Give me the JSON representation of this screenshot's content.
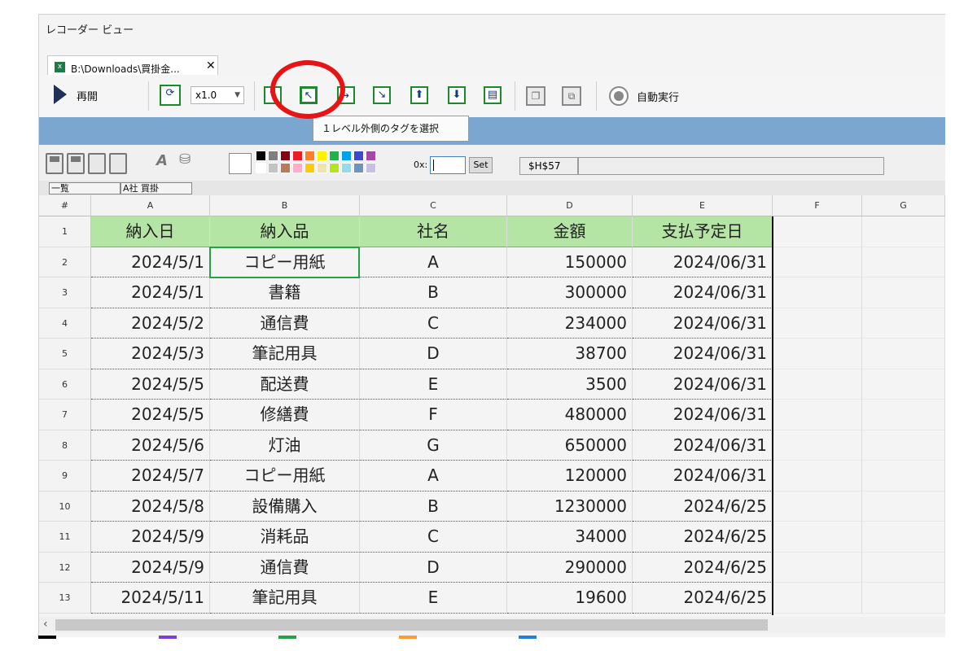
{
  "window": {
    "title": "レコーダー ビュー"
  },
  "tab": {
    "label": "B:\\Downloads\\買掛金...",
    "close": "✕",
    "file_icon": "excel-icon"
  },
  "toolbar": {
    "resume_label": "再開",
    "speed": "x1.0",
    "autorun_label": "自動実行",
    "tooltip": "１レベル外側のタグを選択"
  },
  "formatbar": {
    "ox_label": "0x:",
    "ox_value": "",
    "set_label": "Set",
    "cell_ref": "$H$57",
    "formula": "",
    "palette_top": [
      "#000000",
      "#7f7f7f",
      "#880015",
      "#ed1c24",
      "#ff7f27",
      "#fff200",
      "#22b14c",
      "#00a2e8",
      "#3f48cc",
      "#a349a4"
    ],
    "palette_bottom": [
      "#ffffff",
      "#c3c3c3",
      "#b97a57",
      "#ffaec9",
      "#ffc90e",
      "#efe4b0",
      "#b5e61d",
      "#99d9ea",
      "#7092be",
      "#c8bfe7"
    ]
  },
  "sheets": [
    "一覧",
    "A社 買掛"
  ],
  "columns": [
    "#",
    "A",
    "B",
    "C",
    "D",
    "E",
    "F",
    "G"
  ],
  "header_row": {
    "num": "1",
    "cells": [
      "納入日",
      "納入品",
      "社名",
      "金額",
      "支払予定日"
    ]
  },
  "rows": [
    {
      "num": "2",
      "cells": [
        "2024/5/1",
        "コピー用紙",
        "A",
        "150000",
        "2024/06/31"
      ]
    },
    {
      "num": "3",
      "cells": [
        "2024/5/1",
        "書籍",
        "B",
        "300000",
        "2024/06/31"
      ]
    },
    {
      "num": "4",
      "cells": [
        "2024/5/2",
        "通信費",
        "C",
        "234000",
        "2024/06/31"
      ]
    },
    {
      "num": "5",
      "cells": [
        "2024/5/3",
        "筆記用具",
        "D",
        "38700",
        "2024/06/31"
      ]
    },
    {
      "num": "6",
      "cells": [
        "2024/5/5",
        "配送費",
        "E",
        "3500",
        "2024/06/31"
      ]
    },
    {
      "num": "7",
      "cells": [
        "2024/5/5",
        "修繕費",
        "F",
        "480000",
        "2024/06/31"
      ]
    },
    {
      "num": "8",
      "cells": [
        "2024/5/6",
        "灯油",
        "G",
        "650000",
        "2024/06/31"
      ]
    },
    {
      "num": "9",
      "cells": [
        "2024/5/7",
        "コピー用紙",
        "A",
        "120000",
        "2024/06/31"
      ]
    },
    {
      "num": "10",
      "cells": [
        "2024/5/8",
        "設備購入",
        "B",
        "1230000",
        "2024/6/25"
      ]
    },
    {
      "num": "11",
      "cells": [
        "2024/5/9",
        "消耗品",
        "C",
        "34000",
        "2024/6/25"
      ]
    },
    {
      "num": "12",
      "cells": [
        "2024/5/9",
        "通信費",
        "D",
        "290000",
        "2024/6/25"
      ]
    },
    {
      "num": "13",
      "cells": [
        "2024/5/11",
        "筆記用具",
        "E",
        "19600",
        "2024/6/25"
      ]
    }
  ],
  "colors": {
    "header_green": "#b5e5a5",
    "selection": "#25a244",
    "band_blue": "#7ba6cf",
    "highlight_red": "#e61414"
  }
}
